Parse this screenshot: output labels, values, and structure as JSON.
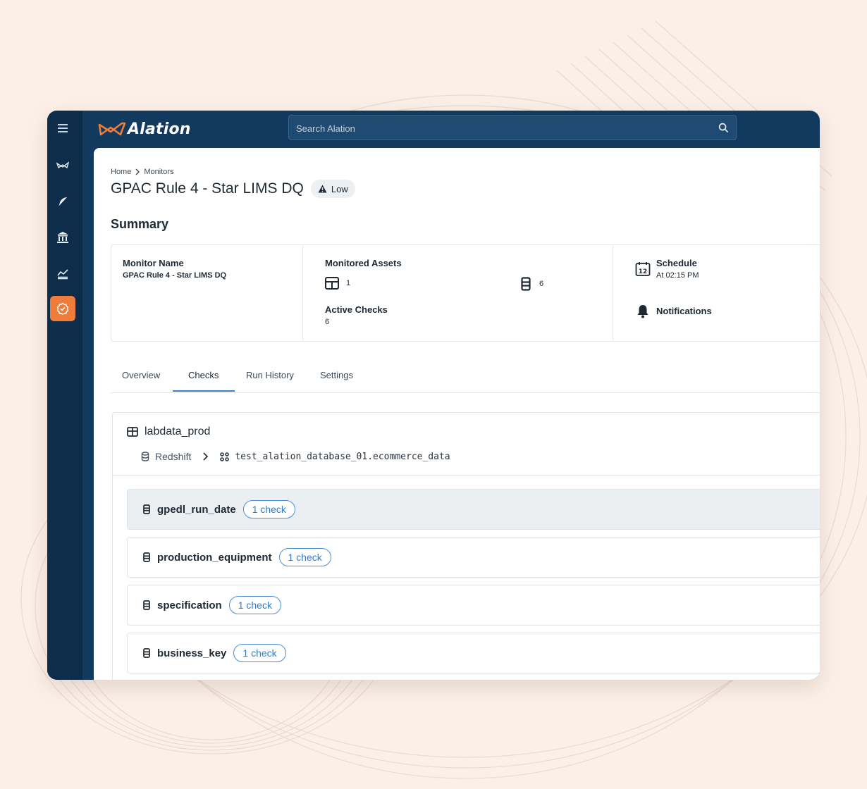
{
  "app": {
    "brand": "Alation",
    "accent": "#ee7d3b",
    "nav_bg": "#0d2d4b"
  },
  "rail": {
    "items": [
      {
        "icon": "hamburger-menu-icon"
      },
      {
        "icon": "alation-logo-icon"
      },
      {
        "icon": "compose-feather-icon"
      },
      {
        "icon": "catalog-building-icon"
      },
      {
        "icon": "analytics-chart-icon"
      },
      {
        "icon": "data-quality-badge-icon",
        "active": true
      }
    ]
  },
  "search": {
    "placeholder": "Search Alation"
  },
  "breadcrumb": {
    "home": "Home",
    "current": "Monitors"
  },
  "page": {
    "title": "GPAC Rule 4 - Star LIMS DQ",
    "severity": "Low"
  },
  "summary": {
    "heading": "Summary",
    "monitor_name_label": "Monitor Name",
    "monitor_name_value": "GPAC Rule 4 - Star LIMS DQ",
    "monitored_assets_label": "Monitored Assets",
    "tables_count": "1",
    "columns_count": "6",
    "active_checks_label": "Active Checks",
    "active_checks_value": "6",
    "schedule_label": "Schedule",
    "schedule_value": "At 02:15 PM",
    "calendar_day": "12",
    "notifications_label": "Notifications"
  },
  "tabs": [
    {
      "label": "Overview"
    },
    {
      "label": "Checks",
      "active": true
    },
    {
      "label": "Run History"
    },
    {
      "label": "Settings"
    }
  ],
  "table": {
    "name": "labdata_prod",
    "source": "Redshift",
    "schema": "test_alation_database_01.ecommerce_data",
    "columns": [
      {
        "name": "gpedl_run_date",
        "checks": "1 check",
        "hover": true
      },
      {
        "name": "production_equipment",
        "checks": "1 check"
      },
      {
        "name": "specification",
        "checks": "1 check"
      },
      {
        "name": "business_key",
        "checks": "1 check"
      }
    ]
  }
}
